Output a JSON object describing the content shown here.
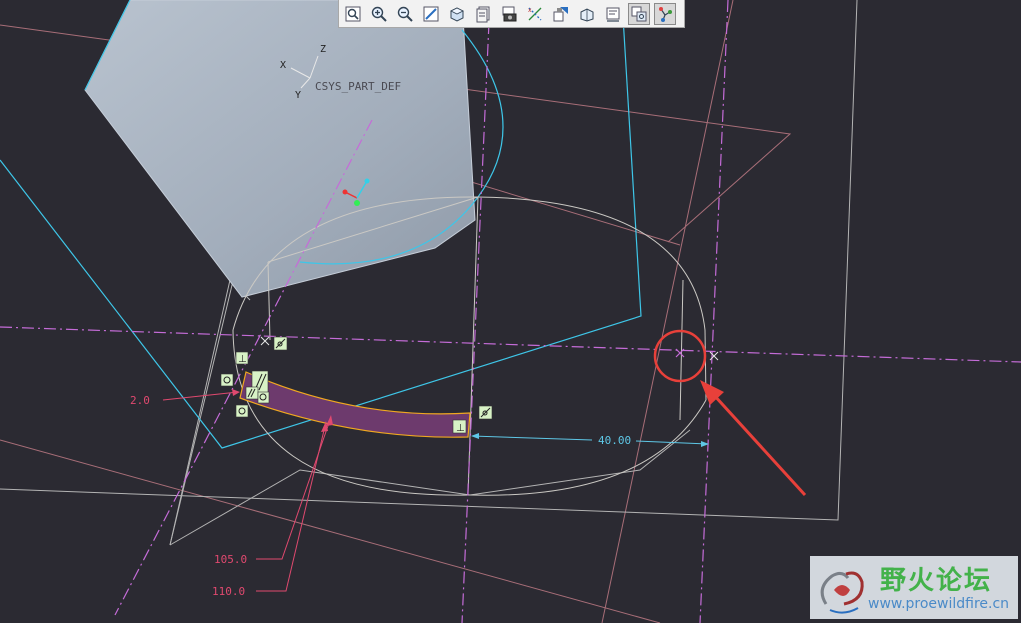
{
  "toolbar": {
    "buttons": [
      {
        "name": "zoom-refit",
        "icon": "zoom-refit-icon"
      },
      {
        "name": "zoom-in",
        "icon": "zoom-in-icon"
      },
      {
        "name": "zoom-out",
        "icon": "zoom-out-icon"
      },
      {
        "name": "repaint",
        "icon": "repaint-icon"
      },
      {
        "name": "display-style",
        "icon": "display-style-icon"
      },
      {
        "name": "saved-views",
        "icon": "saved-views-icon"
      },
      {
        "name": "view-manager",
        "icon": "view-manager-icon"
      },
      {
        "name": "datum-display",
        "icon": "datum-display-icon"
      },
      {
        "name": "annotation-display",
        "icon": "annotation-display-icon"
      },
      {
        "name": "spin-center",
        "icon": "spin-center-icon"
      },
      {
        "name": "sketch-view",
        "icon": "sketch-view-icon"
      },
      {
        "name": "sketcher-display",
        "icon": "sketcher-display-icon"
      },
      {
        "name": "constraint-display",
        "icon": "constraint-display-icon"
      }
    ]
  },
  "csys": {
    "label": "CSYS_PART_DEF",
    "axis_x": "X",
    "axis_y": "Y",
    "axis_z": "Z"
  },
  "dimensions": {
    "thickness": "2.0",
    "radius_inner": "105.0",
    "radius_outer": "110.0",
    "offset": "40.00"
  },
  "colors": {
    "background": "#2b2a32",
    "part_surface": "#a9b4c2",
    "sketch_entity": "#cbc9c4",
    "centerline": "#c56cd8",
    "reference_cyan": "#3ec6e8",
    "datum_plane": "#a86e78",
    "dimension_pink": "#e0496f",
    "dimension_cyan": "#5ec7e6",
    "selection_fill": "#6d3a6d",
    "selection_edge": "#f0a820",
    "callout_red": "#e8403a",
    "constraint_box": "#d8f2c6"
  },
  "watermark": {
    "title": "野火论坛",
    "url": "www.proewildfire.cn"
  }
}
